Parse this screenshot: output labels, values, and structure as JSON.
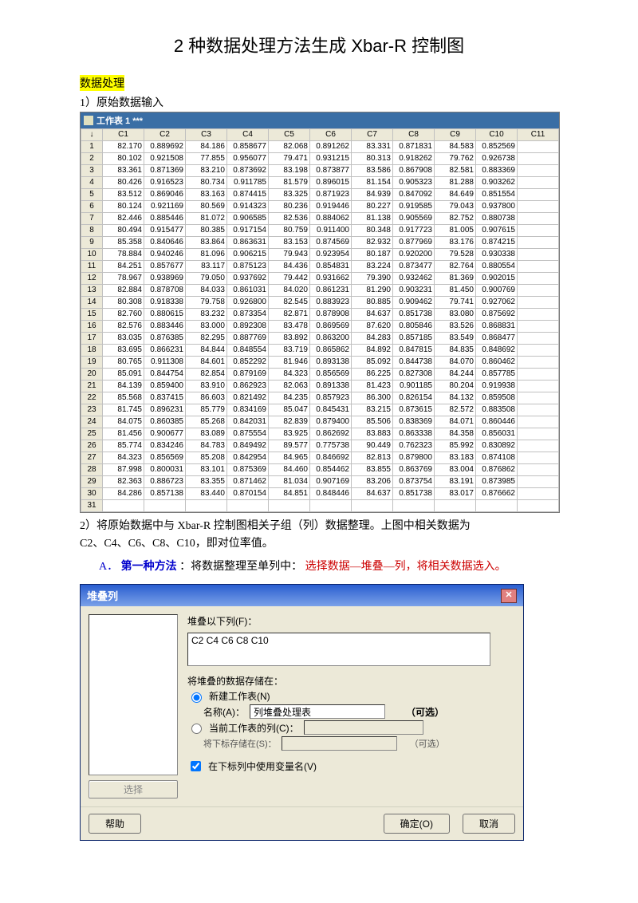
{
  "title": "2 种数据处理方法生成 Xbar-R 控制图",
  "section1_label": "数据处理",
  "section2_label": "1）原始数据输入",
  "worksheet_title": "工作表  1 ***",
  "columns": [
    "C1",
    "C2",
    "C3",
    "C4",
    "C5",
    "C6",
    "C7",
    "C8",
    "C9",
    "C10",
    "C11"
  ],
  "rows": [
    [
      "82.170",
      "0.889692",
      "84.186",
      "0.858677",
      "82.068",
      "0.891262",
      "83.331",
      "0.871831",
      "84.583",
      "0.852569",
      ""
    ],
    [
      "80.102",
      "0.921508",
      "77.855",
      "0.956077",
      "79.471",
      "0.931215",
      "80.313",
      "0.918262",
      "79.762",
      "0.926738",
      ""
    ],
    [
      "83.361",
      "0.871369",
      "83.210",
      "0.873692",
      "83.198",
      "0.873877",
      "83.586",
      "0.867908",
      "82.581",
      "0.883369",
      ""
    ],
    [
      "80.426",
      "0.916523",
      "80.734",
      "0.911785",
      "81.579",
      "0.896015",
      "81.154",
      "0.905323",
      "81.288",
      "0.903262",
      ""
    ],
    [
      "83.512",
      "0.869046",
      "83.163",
      "0.874415",
      "83.325",
      "0.871923",
      "84.939",
      "0.847092",
      "84.649",
      "0.851554",
      ""
    ],
    [
      "80.124",
      "0.921169",
      "80.569",
      "0.914323",
      "80.236",
      "0.919446",
      "80.227",
      "0.919585",
      "79.043",
      "0.937800",
      ""
    ],
    [
      "82.446",
      "0.885446",
      "81.072",
      "0.906585",
      "82.536",
      "0.884062",
      "81.138",
      "0.905569",
      "82.752",
      "0.880738",
      ""
    ],
    [
      "80.494",
      "0.915477",
      "80.385",
      "0.917154",
      "80.759",
      "0.911400",
      "80.348",
      "0.917723",
      "81.005",
      "0.907615",
      ""
    ],
    [
      "85.358",
      "0.840646",
      "83.864",
      "0.863631",
      "83.153",
      "0.874569",
      "82.932",
      "0.877969",
      "83.176",
      "0.874215",
      ""
    ],
    [
      "78.884",
      "0.940246",
      "81.096",
      "0.906215",
      "79.943",
      "0.923954",
      "80.187",
      "0.920200",
      "79.528",
      "0.930338",
      ""
    ],
    [
      "84.251",
      "0.857677",
      "83.117",
      "0.875123",
      "84.436",
      "0.854831",
      "83.224",
      "0.873477",
      "82.764",
      "0.880554",
      ""
    ],
    [
      "78.967",
      "0.938969",
      "79.050",
      "0.937692",
      "79.442",
      "0.931662",
      "79.390",
      "0.932462",
      "81.369",
      "0.902015",
      ""
    ],
    [
      "82.884",
      "0.878708",
      "84.033",
      "0.861031",
      "84.020",
      "0.861231",
      "81.290",
      "0.903231",
      "81.450",
      "0.900769",
      ""
    ],
    [
      "80.308",
      "0.918338",
      "79.758",
      "0.926800",
      "82.545",
      "0.883923",
      "80.885",
      "0.909462",
      "79.741",
      "0.927062",
      ""
    ],
    [
      "82.760",
      "0.880615",
      "83.232",
      "0.873354",
      "82.871",
      "0.878908",
      "84.637",
      "0.851738",
      "83.080",
      "0.875692",
      ""
    ],
    [
      "82.576",
      "0.883446",
      "83.000",
      "0.892308",
      "83.478",
      "0.869569",
      "87.620",
      "0.805846",
      "83.526",
      "0.868831",
      ""
    ],
    [
      "83.035",
      "0.876385",
      "82.295",
      "0.887769",
      "83.892",
      "0.863200",
      "84.283",
      "0.857185",
      "83.549",
      "0.868477",
      ""
    ],
    [
      "83.695",
      "0.866231",
      "84.844",
      "0.848554",
      "83.719",
      "0.865862",
      "84.892",
      "0.847815",
      "84.835",
      "0.848692",
      ""
    ],
    [
      "80.765",
      "0.911308",
      "84.601",
      "0.852292",
      "81.946",
      "0.893138",
      "85.092",
      "0.844738",
      "84.070",
      "0.860462",
      ""
    ],
    [
      "85.091",
      "0.844754",
      "82.854",
      "0.879169",
      "84.323",
      "0.856569",
      "86.225",
      "0.827308",
      "84.244",
      "0.857785",
      ""
    ],
    [
      "84.139",
      "0.859400",
      "83.910",
      "0.862923",
      "82.063",
      "0.891338",
      "81.423",
      "0.901185",
      "80.204",
      "0.919938",
      ""
    ],
    [
      "85.568",
      "0.837415",
      "86.603",
      "0.821492",
      "84.235",
      "0.857923",
      "86.300",
      "0.826154",
      "84.132",
      "0.859508",
      ""
    ],
    [
      "81.745",
      "0.896231",
      "85.779",
      "0.834169",
      "85.047",
      "0.845431",
      "83.215",
      "0.873615",
      "82.572",
      "0.883508",
      ""
    ],
    [
      "84.075",
      "0.860385",
      "85.268",
      "0.842031",
      "82.839",
      "0.879400",
      "85.506",
      "0.838369",
      "84.071",
      "0.860446",
      ""
    ],
    [
      "81.456",
      "0.900677",
      "83.089",
      "0.875554",
      "83.925",
      "0.862692",
      "83.883",
      "0.863338",
      "84.358",
      "0.856031",
      ""
    ],
    [
      "85.774",
      "0.834246",
      "84.783",
      "0.849492",
      "89.577",
      "0.775738",
      "90.449",
      "0.762323",
      "85.992",
      "0.830892",
      ""
    ],
    [
      "84.323",
      "0.856569",
      "85.208",
      "0.842954",
      "84.965",
      "0.846692",
      "82.813",
      "0.879800",
      "83.183",
      "0.874108",
      ""
    ],
    [
      "87.998",
      "0.800031",
      "83.101",
      "0.875369",
      "84.460",
      "0.854462",
      "83.855",
      "0.863769",
      "83.004",
      "0.876862",
      ""
    ],
    [
      "82.363",
      "0.886723",
      "83.355",
      "0.871462",
      "81.034",
      "0.907169",
      "83.206",
      "0.873754",
      "83.191",
      "0.873985",
      ""
    ],
    [
      "84.286",
      "0.857138",
      "83.440",
      "0.870154",
      "84.851",
      "0.848446",
      "84.637",
      "0.851738",
      "83.017",
      "0.876662",
      ""
    ]
  ],
  "note1": "2）将原始数据中与 Xbar-R 控制图相关子组（列）数据整理。上图中相关数据为",
  "note2": "C2、C4、C6、C8、C10，即对位率值。",
  "method_label_a": "A．",
  "method_label_b": "第一种方法",
  "method_text": "：将数据整理至单列中：",
  "method_red": "选择数据—堆叠—列，将相关数据选入。",
  "dialog": {
    "title": "堆叠列",
    "label_stack": "堆叠以下列(F)：",
    "stack_value": "C2 C4 C6 C8 C10",
    "label_store": "将堆叠的数据存储在：",
    "radio_new": "新建工作表(N)",
    "label_name": "名称(A)：",
    "name_value": "列堆叠处理表",
    "optional": "（可选）",
    "radio_current": "当前工作表的列(C)：",
    "label_sub": "将下标存储在(S)：",
    "check_usevar": "在下标列中使用变量名(V)",
    "btn_select": "选择",
    "btn_help": "帮助",
    "btn_ok": "确定(O)",
    "btn_cancel": "取消"
  }
}
